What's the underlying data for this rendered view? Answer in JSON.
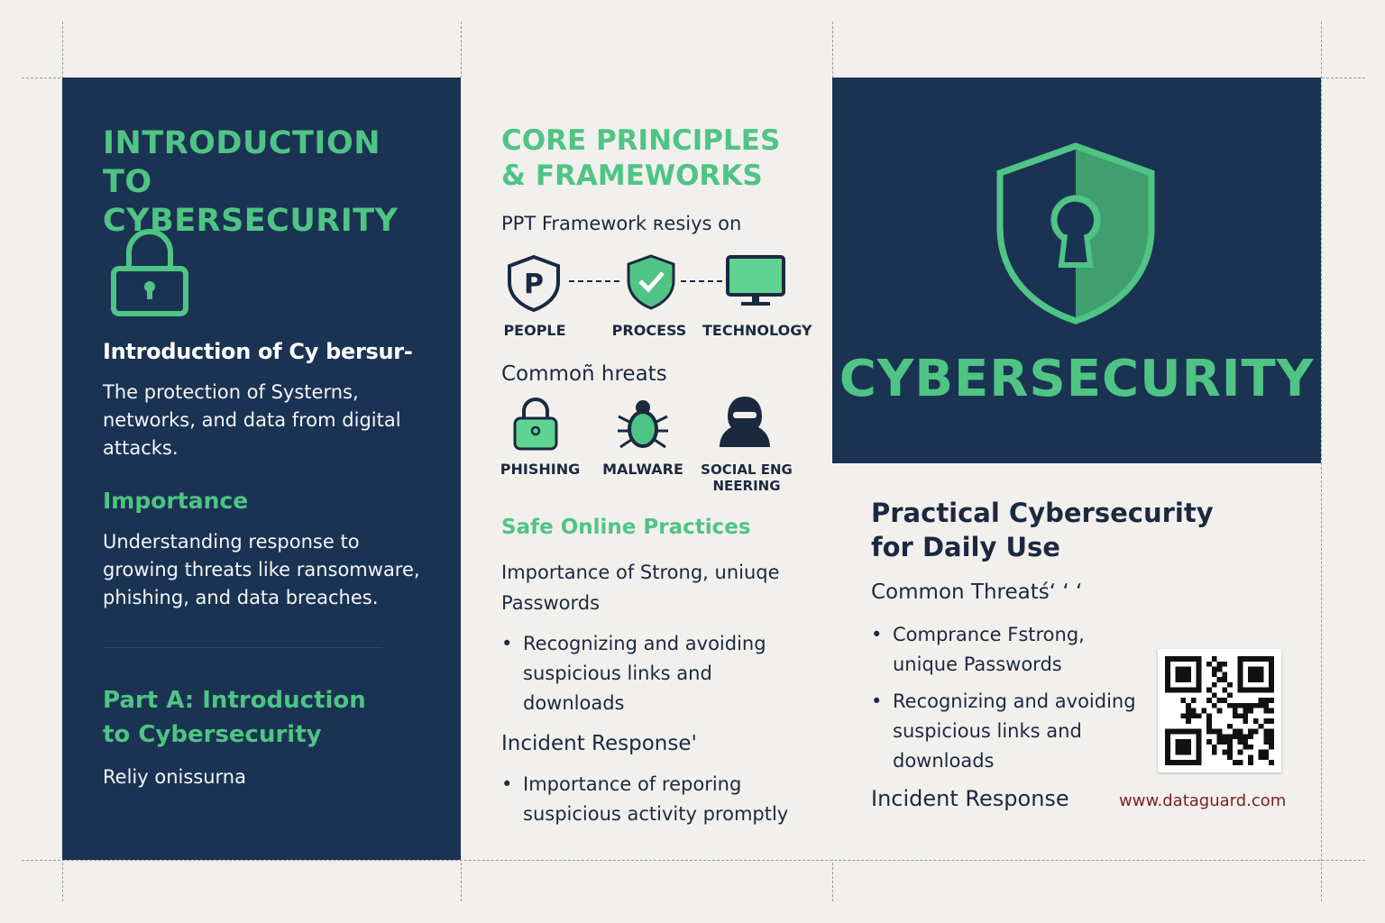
{
  "left_panel": {
    "heading": "INTRODUCTION TO CYBERSECURITY",
    "intro_title": "Introduction of Cy bersur-",
    "intro_text": "The protection of Systerns, networks, and data from digital attacks.",
    "importance_title": "Importance",
    "importance_text": "Understanding response to growing threats like ransomware, phishing, and data breaches.",
    "part_a_title": "Part A: Introduction to Cybersecurity",
    "part_a_text": "Reliy onissurna"
  },
  "middle_panel": {
    "heading": "CORE PRINCIPLES & FRAMEWORKS",
    "ppt_line": "PPT Framework ʀesiys on",
    "ppt_items": [
      "PEOPLE",
      "PROCESS",
      "TECHNOLOGY"
    ],
    "threats_title": "Commoñ hreats",
    "threat_items": [
      "PHISHING",
      "MALWARE",
      "SOCIAL ENG NEERING"
    ],
    "safe_title": "Safe Online Practices",
    "passwords_text": "Importance of Strong, uniuqe Passwords",
    "safe_bullets": [
      "Recognizing and avoiding suspicious links and downloads"
    ],
    "incident_title": "Incident Response'",
    "incident_bullets": [
      "Importance of reporing suspicious activity promptly"
    ]
  },
  "right_panel": {
    "cover_title": "CYBERSECURITY",
    "practical_title": "Practical Cybersecurity for Daily Use",
    "threats_title": "Common Threatś‘ ‘ ‘",
    "bullets": [
      "Comprance Fstrong, unique Passwords",
      "Recognizing and avoiding suspicious links and downloads"
    ],
    "incident_title": "Incident Response",
    "url": "www.dataguard.com"
  },
  "colors": {
    "navy": "#1b3352",
    "green": "#4fc484",
    "paper": "#f2f0ed",
    "url_red": "#7a1f1f"
  },
  "icons": [
    "padlock-icon",
    "p-shield-icon",
    "check-shield-icon",
    "monitor-icon",
    "lock-icon",
    "bug-icon",
    "hacker-icon",
    "keyhole-shield-icon",
    "qr-code"
  ]
}
